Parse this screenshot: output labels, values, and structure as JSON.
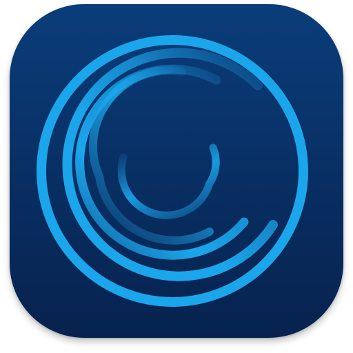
{
  "icon": {
    "name": "spiral-rings-app-icon",
    "style": "rounded-square",
    "colors": {
      "background_top": "#0a3d7a",
      "background_bottom": "#07224e",
      "ring": "#1ba6ec"
    }
  }
}
